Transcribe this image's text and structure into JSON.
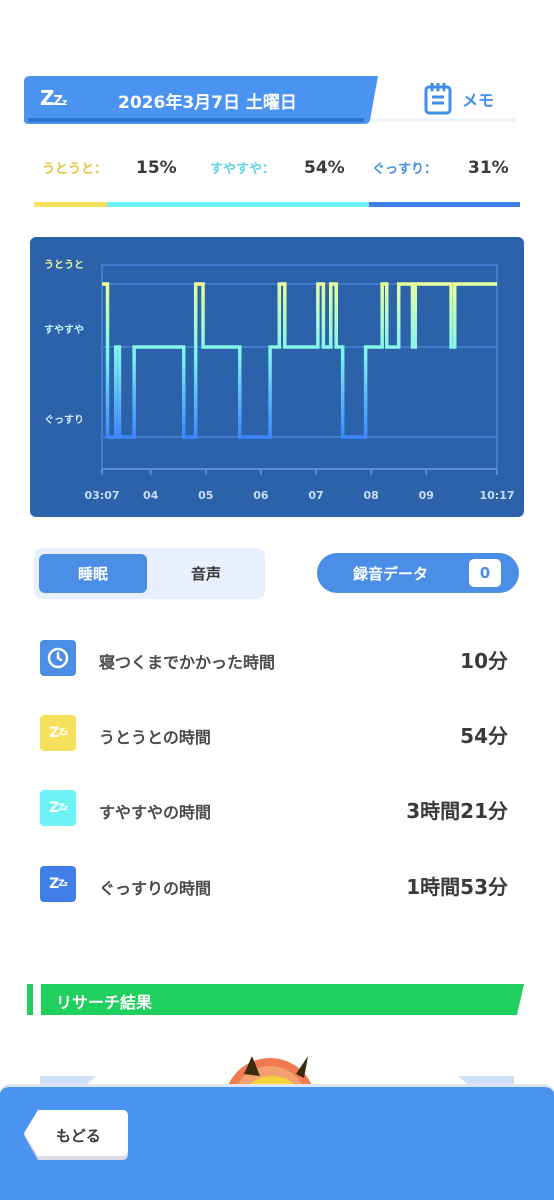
{
  "header": {
    "icon": "zzz-sleep-icon",
    "date": "2026年3月7日 土曜日",
    "memo_label": "メモ",
    "memo_icon": "notepad-icon"
  },
  "ratios": [
    {
      "label": "うとうと：",
      "value": "15%",
      "color": "#f7e15c"
    },
    {
      "label": "すやすや：",
      "value": "54%",
      "color": "#6ff2f5"
    },
    {
      "label": "ぐっすり：",
      "value": "31%",
      "color": "#3f7fe6"
    }
  ],
  "chart_data": {
    "type": "line",
    "y_categories": [
      "うとうと",
      "すやすや",
      "ぐっすり"
    ],
    "x_tick_labels": [
      "03:07",
      "04",
      "05",
      "06",
      "07",
      "08",
      "09",
      "10:17"
    ],
    "x_start": "03:07",
    "x_end": "10:17",
    "x_ticks_minutes": [
      0,
      53,
      113,
      173,
      233,
      293,
      353,
      430
    ],
    "steps": [
      {
        "t": 0,
        "level": 0
      },
      {
        "t": 6,
        "level": 2
      },
      {
        "t": 15,
        "level": 1
      },
      {
        "t": 19,
        "level": 2
      },
      {
        "t": 35,
        "level": 1
      },
      {
        "t": 89,
        "level": 2
      },
      {
        "t": 102,
        "level": 0
      },
      {
        "t": 110,
        "level": 1
      },
      {
        "t": 150,
        "level": 2
      },
      {
        "t": 183,
        "level": 1
      },
      {
        "t": 193,
        "level": 0
      },
      {
        "t": 199,
        "level": 1
      },
      {
        "t": 235,
        "level": 0
      },
      {
        "t": 241,
        "level": 1
      },
      {
        "t": 249,
        "level": 0
      },
      {
        "t": 255,
        "level": 1
      },
      {
        "t": 262,
        "level": 2
      },
      {
        "t": 287,
        "level": 1
      },
      {
        "t": 305,
        "level": 0
      },
      {
        "t": 310,
        "level": 1
      },
      {
        "t": 323,
        "level": 0
      },
      {
        "t": 338,
        "level": 1
      },
      {
        "t": 341,
        "level": 0
      },
      {
        "t": 380,
        "level": 1
      },
      {
        "t": 384,
        "level": 0
      },
      {
        "t": 430,
        "level": 0
      }
    ],
    "grid": true
  },
  "tabs": [
    {
      "label": "睡眠",
      "active": true
    },
    {
      "label": "音声",
      "active": false
    }
  ],
  "recording": {
    "label": "録音データ",
    "count": "0"
  },
  "stats": [
    {
      "icon": "clock-icon",
      "icon_color": "#4b8ee6",
      "label": "寝つくまでかかった時間",
      "value": "10分"
    },
    {
      "icon": "zzz-light-icon",
      "icon_color": "#f7e15c",
      "label": "うとうとの時間",
      "value": "54分"
    },
    {
      "icon": "zzz-medium-icon",
      "icon_color": "#6ff2f5",
      "label": "すやすやの時間",
      "value": "3時間21分"
    },
    {
      "icon": "zzz-deep-icon",
      "icon_color": "#3f7fe6",
      "label": "ぐっすりの時間",
      "value": "1時間53分"
    }
  ],
  "research": {
    "title": "リサーチ結果",
    "color": "#1fd05f"
  },
  "footer": {
    "back_label": "もどる"
  }
}
